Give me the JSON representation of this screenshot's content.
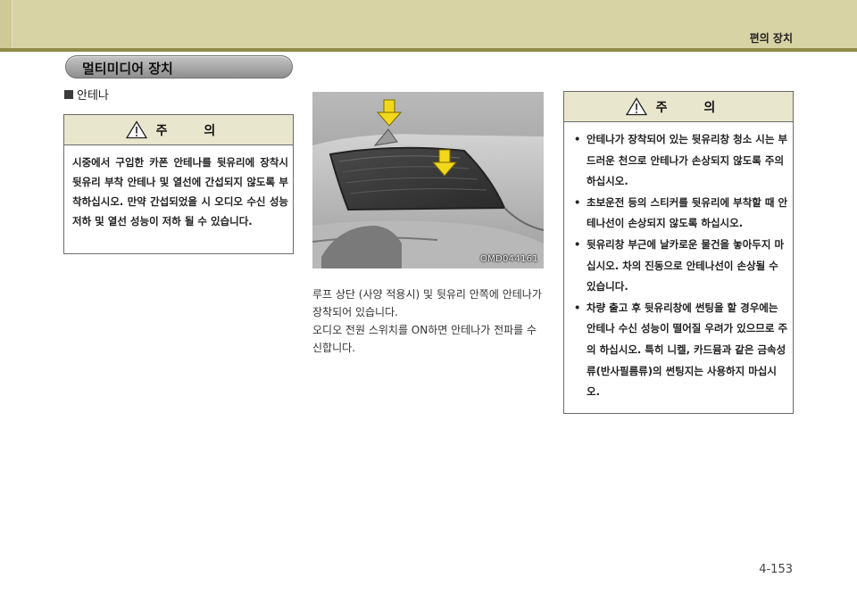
{
  "header": {
    "section_title": "편의 장치"
  },
  "section_pill": {
    "title": "멀티미디어 장치"
  },
  "subsection": {
    "title": "안테나"
  },
  "caution_left": {
    "title": "주 의",
    "icon": "warning-triangle-icon",
    "text": "시중에서 구입한 카폰 안테나를 뒷유리에 장착시 뒷유리 부착 안테나 및 열선에 간섭되지 않도록 부착하십시오. 만약 간섭되었을 시 오디오 수신 성능 저하 및 열선 성능이 저하 될 수 있습니다."
  },
  "figure": {
    "code": "OMD044161"
  },
  "description": {
    "p1": "루프 상단 (사양 적용시) 및 뒷유리 안쪽에 안테나가 장착되어 있습니다.",
    "p2": "오디오 전원 스위치를 ON하면 안테나가 전파를 수신합니다."
  },
  "caution_right": {
    "title": "주 의",
    "icon": "warning-triangle-icon",
    "items": [
      "안테나가 장착되어 있는 뒷유리창 청소 시는 부드러운 천으로 안테나가 손상되지 않도록 주의하십시오.",
      "초보운전 등의 스티커를 뒷유리에 부착할 때 안테나선이 손상되지 않도록 하십시오.",
      "뒷유리창 부근에 날카로운 물건을 놓아두지 마십시오. 차의 진동으로 안테나선이 손상될 수 있습니다.",
      "차량 출고 후 뒷유리창에 썬팅을 할 경우에는 안테나 수신 성능이 떨어질 우려가 있으므로 주의 하십시오. 특히 니켈, 카드뮴과 같은 금속성류(반사필름류)의 썬팅지는 사용하지 마십시오."
    ]
  },
  "page": {
    "number": "4-153"
  },
  "colors": {
    "header_band": "#d8d3a4",
    "header_rule": "#8f8a48",
    "caution_head": "#e8e6cd",
    "arrow_yellow": "#f2d81c"
  }
}
